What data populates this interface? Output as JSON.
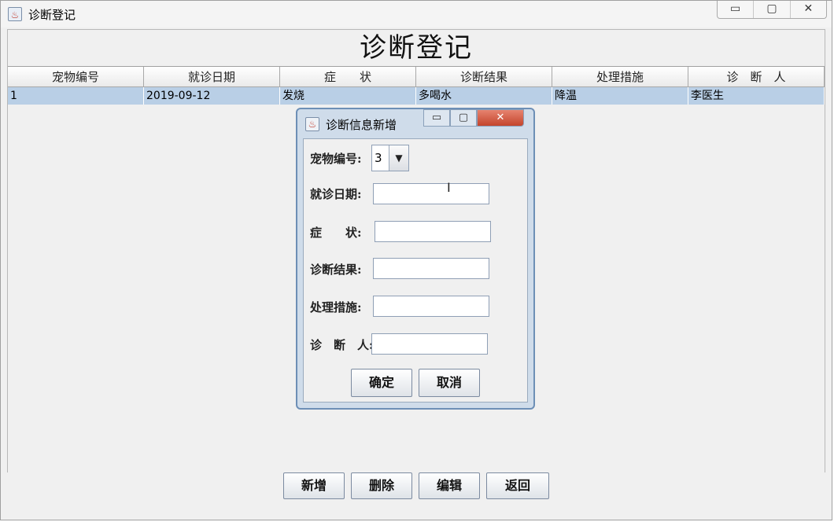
{
  "window": {
    "title": "诊断登记",
    "controls": [
      "▭",
      "▢",
      "✕"
    ]
  },
  "heading": "诊断登记",
  "table": {
    "columns": [
      "宠物编号",
      "就诊日期",
      "症　　状",
      "诊断结果",
      "处理措施",
      "诊　断　人"
    ],
    "rows": [
      [
        "1",
        "2019-09-12",
        "发烧",
        "多喝水",
        "降温",
        "李医生"
      ]
    ]
  },
  "bottom_buttons": [
    "新增",
    "删除",
    "编辑",
    "返回"
  ],
  "dialog": {
    "title": "诊断信息新增",
    "controls": [
      "▭",
      "▢",
      "✕"
    ],
    "pet_id_label": "宠物编号:",
    "pet_id_value": "3",
    "date_label": "就诊日期:",
    "date_value": "",
    "symptom_label": "症　　状:",
    "symptom_value": "",
    "result_label": "诊断结果:",
    "result_value": "",
    "treatment_label": "处理措施:",
    "treatment_value": "",
    "doctor_label": "诊　断　人:",
    "doctor_value": "",
    "confirm_label": "确定",
    "cancel_label": "取消"
  },
  "icons": {
    "app_icon": "java-cup-icon",
    "dropdown": "chevron-down-icon"
  }
}
